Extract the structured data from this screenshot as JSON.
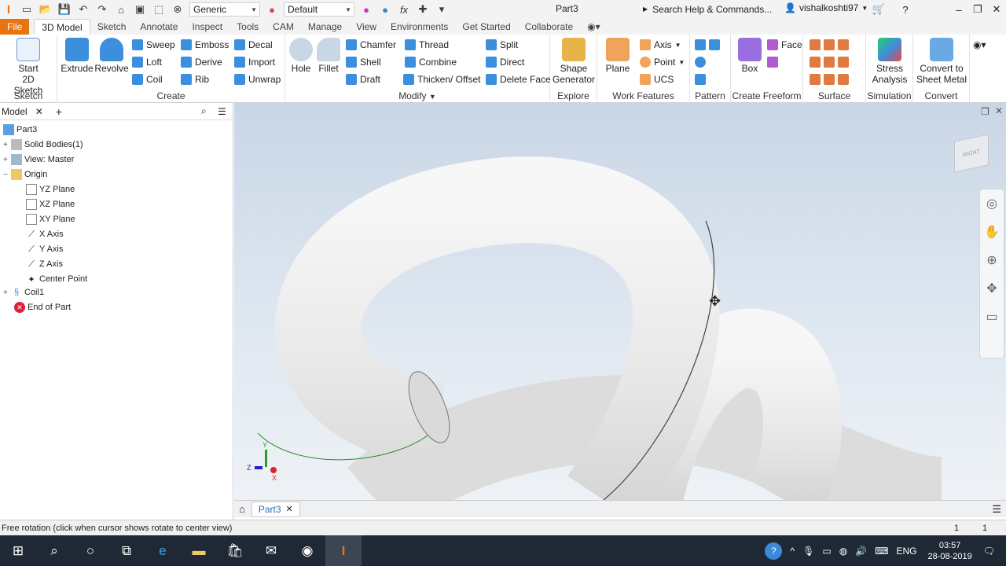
{
  "qat": {
    "logo": "I",
    "material": "Generic",
    "appearance": "Default",
    "fx": "fx",
    "doc_title": "Part3",
    "search": "Search Help & Commands...",
    "user": "vishalkoshti97"
  },
  "tabs": [
    "File",
    "3D Model",
    "Sketch",
    "Annotate",
    "Inspect",
    "Tools",
    "CAM",
    "Manage",
    "View",
    "Environments",
    "Get Started",
    "Collaborate"
  ],
  "ribbon": {
    "sketch": {
      "start": "Start",
      "start2": "2D Sketch",
      "label": "Sketch"
    },
    "create": {
      "extrude": "Extrude",
      "revolve": "Revolve",
      "sweep": "Sweep",
      "emboss": "Emboss",
      "decal": "Decal",
      "loft": "Loft",
      "derive": "Derive",
      "import": "Import",
      "coil": "Coil",
      "rib": "Rib",
      "unwrap": "Unwrap",
      "label": "Create"
    },
    "modify": {
      "hole": "Hole",
      "fillet": "Fillet",
      "chamfer": "Chamfer",
      "thread": "Thread",
      "split": "Split",
      "shell": "Shell",
      "combine": "Combine",
      "direct": "Direct",
      "draft": "Draft",
      "thicken": "Thicken/ Offset",
      "delete_face": "Delete Face",
      "label": "Modify"
    },
    "explore": {
      "shape": "Shape",
      "generator": "Generator",
      "label": "Explore"
    },
    "work": {
      "plane": "Plane",
      "axis": "Axis",
      "point": "Point",
      "ucs": "UCS",
      "label": "Work Features"
    },
    "pattern": {
      "label": "Pattern"
    },
    "freeform": {
      "box": "Box",
      "face": "Face",
      "label": "Create Freeform"
    },
    "surface": {
      "label": "Surface"
    },
    "simulation": {
      "stress": "Stress",
      "analysis": "Analysis",
      "label": "Simulation"
    },
    "convert": {
      "convert": "Convert to",
      "sheet": "Sheet Metal",
      "label": "Convert"
    }
  },
  "browser": {
    "title": "Model",
    "items": [
      "Part3",
      "Solid Bodies(1)",
      "View: Master",
      "Origin",
      "YZ Plane",
      "XZ Plane",
      "XY Plane",
      "X Axis",
      "Y Axis",
      "Z Axis",
      "Center Point",
      "Coil1",
      "End of Part"
    ]
  },
  "doc_tab": "Part3",
  "status": {
    "message": "Free rotation (click when cursor shows rotate to center view)",
    "n1": "1",
    "n2": "1"
  },
  "taskbar": {
    "lang": "ENG",
    "time": "03:57",
    "date": "28-08-2019"
  },
  "viewcube_label": "RIGHT",
  "triad": {
    "x": "X",
    "y": "Y",
    "z": "Z"
  },
  "colors": {
    "accent": "#e8730f",
    "viewport_top": "#c9d6e6",
    "coil": "#ececec"
  }
}
